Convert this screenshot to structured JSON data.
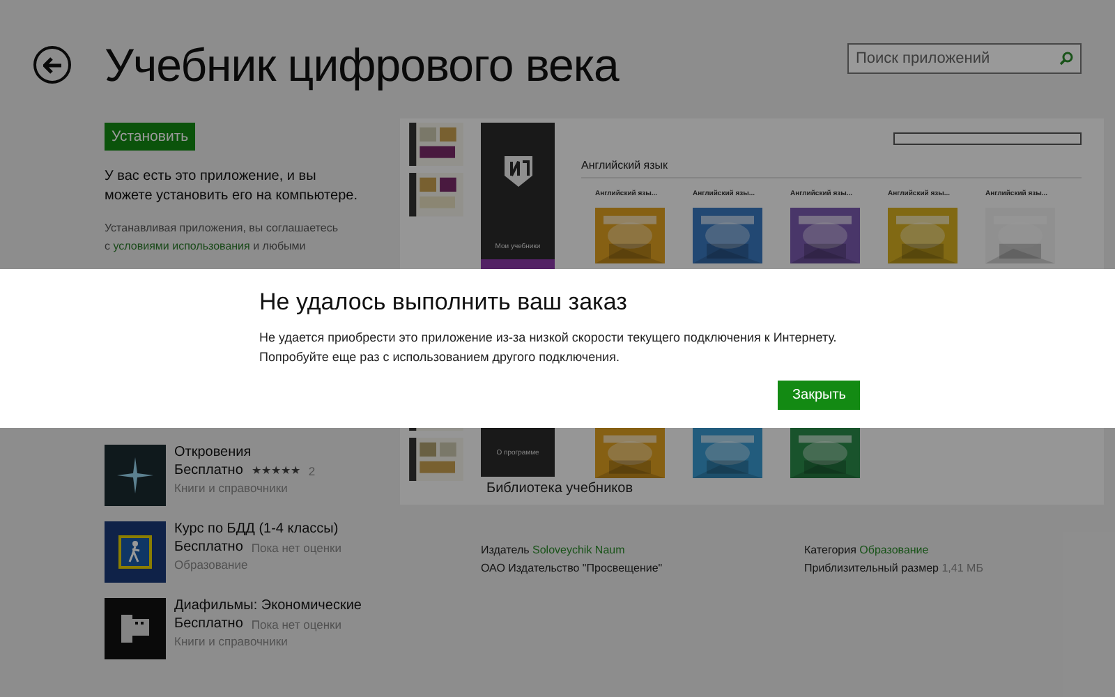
{
  "title": "Учебник цифрового века",
  "search": {
    "placeholder": "Поиск приложений"
  },
  "install_button": "Установить",
  "owned_note": "У вас есть это приложение, и вы можете установить его на компьютере.",
  "terms": {
    "before": "Устанавливая приложения, вы соглашаетесь с ",
    "link": "условиями использования",
    "after": " и любыми"
  },
  "related_apps": [
    {
      "kind": "rated",
      "name": "Откровения",
      "price": "Бесплатно",
      "stars": 5,
      "rating_count": "2",
      "category": "Книги и справочники"
    },
    {
      "kind": "unrated",
      "name": "Курс по БДД (1-4 классы)",
      "price": "Бесплатно",
      "rating": "Пока нет оценки",
      "category": "Образование"
    },
    {
      "kind": "unrated",
      "name": "Диафильмы: Экономические",
      "price": "Бесплатно",
      "rating": "Пока нет оценки",
      "category": "Книги и справочники"
    }
  ],
  "screenshot": {
    "panel_label": "Мои учебники",
    "panel_footer": "О программе",
    "section": "Английский язык",
    "caption": "Библиотека учебников",
    "books": [
      {
        "title": "Английский язы..."
      },
      {
        "title": "Английский язы..."
      },
      {
        "title": "Английский язы..."
      },
      {
        "title": "Английский язы..."
      },
      {
        "title": "Английский язы..."
      }
    ]
  },
  "details": {
    "publisher_label": "Издатель",
    "publisher": "Soloveychik Naum",
    "publisher_org": "ОАО Издательство \"Просвещение\"",
    "category_label": "Категория",
    "category": "Образование",
    "size_label": "Приблизительный размер",
    "size": "1,41 МБ"
  },
  "dialog": {
    "title": "Не удалось выполнить ваш заказ",
    "message": "Не удается приобрести это приложение из-за низкой скорости текущего подключения к Интернету. Попробуйте еще раз с использованием другого подключения.",
    "button": "Закрыть"
  }
}
